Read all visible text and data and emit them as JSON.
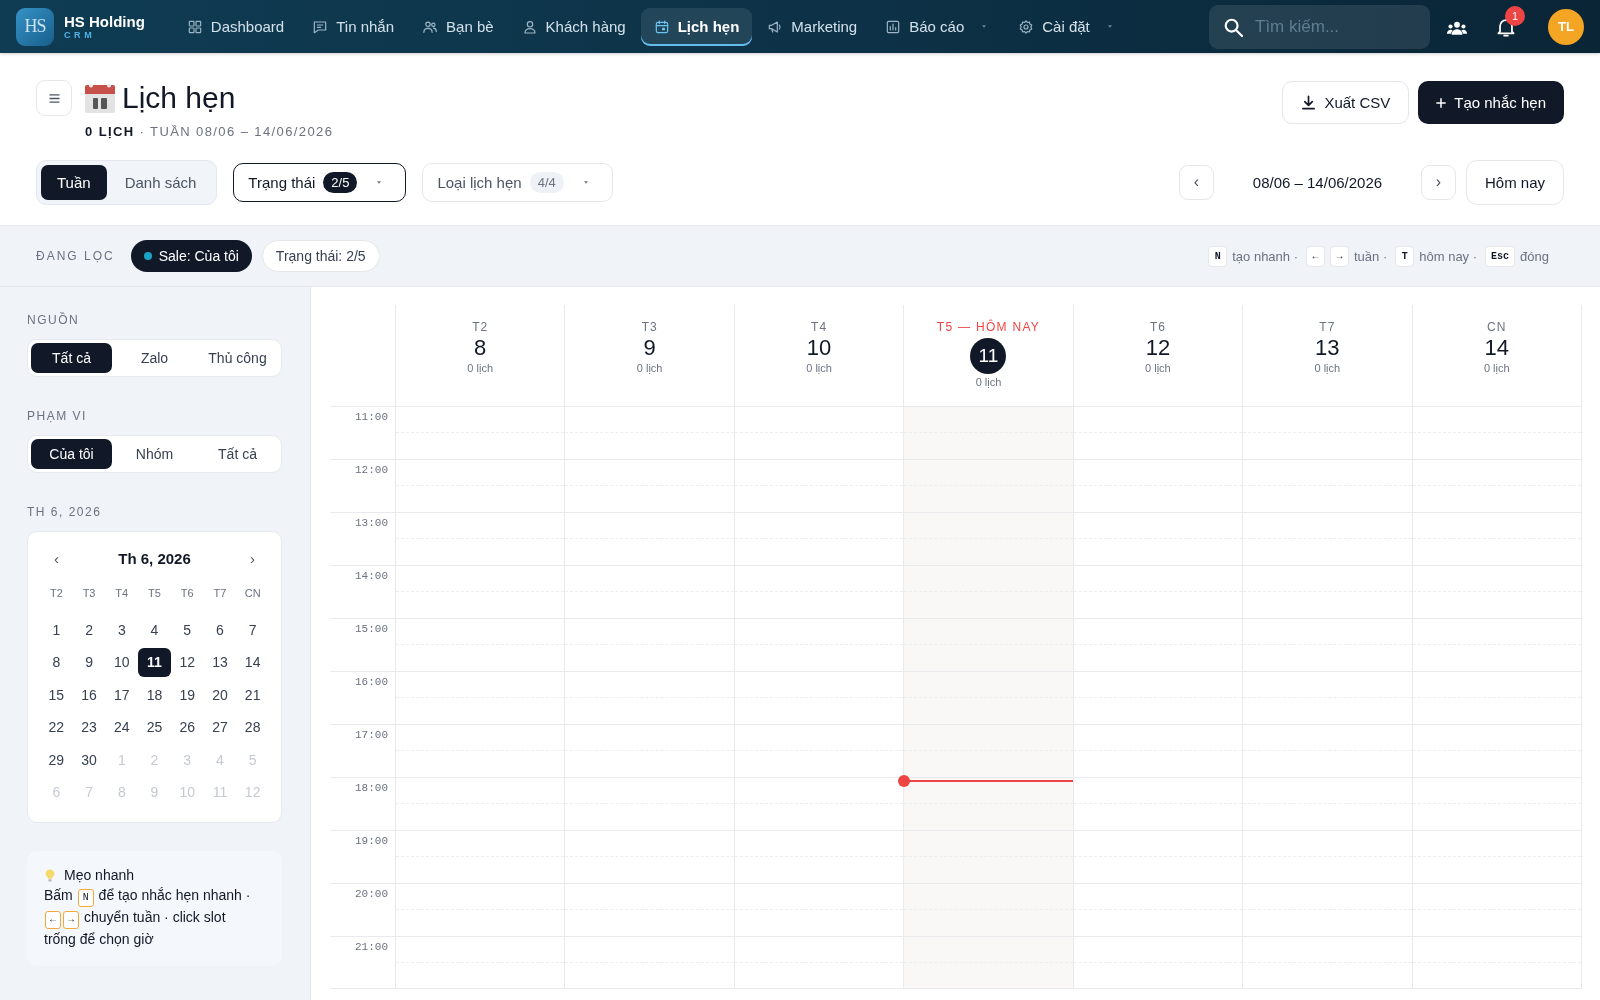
{
  "brand": {
    "logo_text": "HS",
    "name": "HS Holding",
    "subtitle": "CRM"
  },
  "nav": {
    "items": [
      {
        "label": "Dashboard",
        "selected": false,
        "has_menu": false
      },
      {
        "label": "Tin nhắn",
        "selected": false,
        "has_menu": false
      },
      {
        "label": "Bạn bè",
        "selected": false,
        "has_menu": false
      },
      {
        "label": "Khách hàng",
        "selected": false,
        "has_menu": false
      },
      {
        "label": "Lịch hẹn",
        "selected": true,
        "has_menu": false
      },
      {
        "label": "Marketing",
        "selected": false,
        "has_menu": false
      },
      {
        "label": "Báo cáo",
        "selected": false,
        "has_menu": true
      },
      {
        "label": "Cài đặt",
        "selected": false,
        "has_menu": true
      }
    ]
  },
  "search": {
    "placeholder": "Tìm kiếm..."
  },
  "notifications": {
    "badge": "1"
  },
  "user": {
    "initials": "TL"
  },
  "page": {
    "title": "Lịch hẹn",
    "count": "0 LỊCH",
    "range": "· TUẦN 08/06 – 14/06/2026",
    "actions": [
      {
        "label": "Xuất CSV",
        "kind": "secondary"
      },
      {
        "label": "Tạo nhắc hẹn",
        "kind": "primary"
      }
    ]
  },
  "toolbar": {
    "views": [
      {
        "label": "Tuần",
        "selected": true
      },
      {
        "label": "Danh sách",
        "selected": false
      }
    ],
    "filters": [
      {
        "label": "Trạng thái",
        "badge": "2/5",
        "active": true
      },
      {
        "label": "Loại lịch hẹn",
        "badge": "4/4",
        "active": false
      }
    ],
    "week_nav": {
      "prev": "‹",
      "range": "08/06 – 14/06/2026",
      "next": "›",
      "today": "Hôm nay"
    }
  },
  "filter_bar": {
    "label": "ĐANG LỌC",
    "chips": [
      {
        "label": "Sale: Của tôi",
        "kind": "owner",
        "color": "#1ba3c6"
      },
      {
        "label": "Trạng thái: 2/5",
        "kind": "status"
      }
    ],
    "shortcuts": [
      {
        "keys": [
          "N"
        ],
        "label": "tạo nhanh ·"
      },
      {
        "keys": [
          "←",
          "→"
        ],
        "label": "tuần ·"
      },
      {
        "keys": [
          "T"
        ],
        "label": "hôm nay ·"
      },
      {
        "keys": [
          "Esc"
        ],
        "label": "đóng"
      }
    ]
  },
  "sidebar": {
    "source": {
      "title": "NGUỒN",
      "options": [
        {
          "label": "Tất cả",
          "selected": true
        },
        {
          "label": "Zalo",
          "selected": false
        },
        {
          "label": "Thủ công",
          "selected": false
        }
      ]
    },
    "scope": {
      "title": "PHẠM VI",
      "options": [
        {
          "label": "Của tôi",
          "selected": true
        },
        {
          "label": "Nhóm",
          "selected": false
        },
        {
          "label": "Tất cả",
          "selected": false
        }
      ]
    },
    "month": {
      "title": "TH 6, 2026",
      "header": "Th 6, 2026",
      "prev": "‹",
      "next": "›",
      "weekdays": [
        "T2",
        "T3",
        "T4",
        "T5",
        "T6",
        "T7",
        "CN"
      ],
      "days": [
        {
          "label": "1",
          "muted": false,
          "selected": false
        },
        {
          "label": "2",
          "muted": false,
          "selected": false
        },
        {
          "label": "3",
          "muted": false,
          "selected": false
        },
        {
          "label": "4",
          "muted": false,
          "selected": false
        },
        {
          "label": "5",
          "muted": false,
          "selected": false
        },
        {
          "label": "6",
          "muted": false,
          "selected": false
        },
        {
          "label": "7",
          "muted": false,
          "selected": false
        },
        {
          "label": "8",
          "muted": false,
          "selected": false
        },
        {
          "label": "9",
          "muted": false,
          "selected": false
        },
        {
          "label": "10",
          "muted": false,
          "selected": false
        },
        {
          "label": "11",
          "muted": false,
          "selected": true
        },
        {
          "label": "12",
          "muted": false,
          "selected": false
        },
        {
          "label": "13",
          "muted": false,
          "selected": false
        },
        {
          "label": "14",
          "muted": false,
          "selected": false
        },
        {
          "label": "15",
          "muted": false,
          "selected": false
        },
        {
          "label": "16",
          "muted": false,
          "selected": false
        },
        {
          "label": "17",
          "muted": false,
          "selected": false
        },
        {
          "label": "18",
          "muted": false,
          "selected": false
        },
        {
          "label": "19",
          "muted": false,
          "selected": false
        },
        {
          "label": "20",
          "muted": false,
          "selected": false
        },
        {
          "label": "21",
          "muted": false,
          "selected": false
        },
        {
          "label": "22",
          "muted": false,
          "selected": false
        },
        {
          "label": "23",
          "muted": false,
          "selected": false
        },
        {
          "label": "24",
          "muted": false,
          "selected": false
        },
        {
          "label": "25",
          "muted": false,
          "selected": false
        },
        {
          "label": "26",
          "muted": false,
          "selected": false
        },
        {
          "label": "27",
          "muted": false,
          "selected": false
        },
        {
          "label": "28",
          "muted": false,
          "selected": false
        },
        {
          "label": "29",
          "muted": false,
          "selected": false
        },
        {
          "label": "30",
          "muted": false,
          "selected": false
        },
        {
          "label": "1",
          "muted": true,
          "selected": false
        },
        {
          "label": "2",
          "muted": true,
          "selected": false
        },
        {
          "label": "3",
          "muted": true,
          "selected": false
        },
        {
          "label": "4",
          "muted": true,
          "selected": false
        },
        {
          "label": "5",
          "muted": true,
          "selected": false
        },
        {
          "label": "6",
          "muted": true,
          "selected": false
        },
        {
          "label": "7",
          "muted": true,
          "selected": false
        },
        {
          "label": "8",
          "muted": true,
          "selected": false
        },
        {
          "label": "9",
          "muted": true,
          "selected": false
        },
        {
          "label": "10",
          "muted": true,
          "selected": false
        },
        {
          "label": "11",
          "muted": true,
          "selected": false
        },
        {
          "label": "12",
          "muted": true,
          "selected": false
        }
      ]
    },
    "tip": {
      "title": "Mẹo nhanh",
      "parts": [
        {
          "kind": "text",
          "text": "Bấm "
        },
        {
          "kind": "key",
          "text": "N"
        },
        {
          "kind": "text",
          "text": " để tạo nhắc hẹn nhanh · "
        },
        {
          "kind": "key",
          "text": "←"
        },
        {
          "kind": "key",
          "text": "→"
        },
        {
          "kind": "text",
          "text": " chuyển tuần · click slot trống để chọn giờ"
        }
      ]
    }
  },
  "calendar": {
    "days": [
      {
        "weekday": "T2",
        "date": "8",
        "count": "0 lịch",
        "today": false
      },
      {
        "weekday": "T3",
        "date": "9",
        "count": "0 lịch",
        "today": false
      },
      {
        "weekday": "T4",
        "date": "10",
        "count": "0 lịch",
        "today": false
      },
      {
        "weekday": "T5 — HÔM NAY",
        "date": "11",
        "count": "0 lịch",
        "today": true
      },
      {
        "weekday": "T6",
        "date": "12",
        "count": "0 lịch",
        "today": false
      },
      {
        "weekday": "T7",
        "date": "13",
        "count": "0 lịch",
        "today": false
      },
      {
        "weekday": "CN",
        "date": "14",
        "count": "0 lịch",
        "today": false
      }
    ],
    "hours": [
      {
        "label": "11:00",
        "now": false
      },
      {
        "label": "12:00",
        "now": false
      },
      {
        "label": "13:00",
        "now": false
      },
      {
        "label": "14:00",
        "now": false
      },
      {
        "label": "15:00",
        "now": false
      },
      {
        "label": "16:00",
        "now": false
      },
      {
        "label": "17:00",
        "now": false
      },
      {
        "label": "18:00",
        "now": true
      },
      {
        "label": "19:00",
        "now": false
      },
      {
        "label": "20:00",
        "now": false
      },
      {
        "label": "21:00",
        "now": false
      }
    ]
  }
}
